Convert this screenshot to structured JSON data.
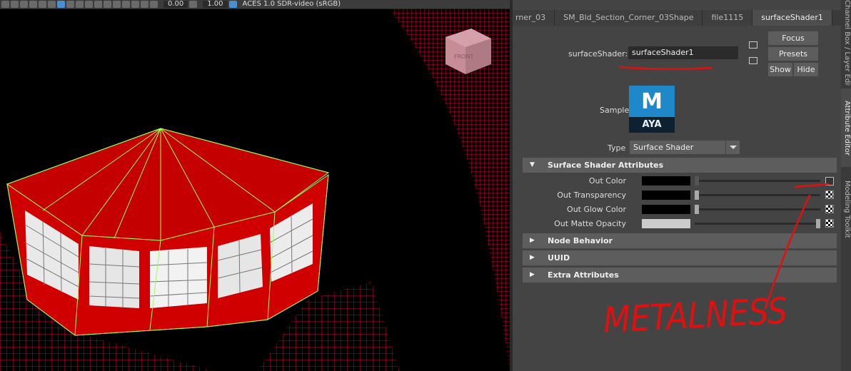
{
  "viewport": {
    "toolbar": {
      "field_a": "0.00",
      "field_b": "1.00",
      "color_space": "ACES 1.0 SDR-video (sRGB)"
    },
    "viewcube": {
      "face_label": "FRONT"
    },
    "object_color": "#d10000",
    "wireframe_color": "#9dff57",
    "grid_color": "#c2003b"
  },
  "attribute_editor": {
    "tabs": [
      "rner_03",
      "SM_Bld_Section_Corner_03Shape",
      "file1115",
      "surfaceShader1"
    ],
    "active_tab": "surfaceShader1",
    "shader_label": "surfaceShader:",
    "shader_name": "surfaceShader1",
    "buttons": {
      "focus": "Focus",
      "presets": "Presets",
      "show": "Show",
      "hide": "Hide"
    },
    "sample_label": "Sample",
    "sample_icon": {
      "top": "M",
      "bottom": "AYA"
    },
    "type_label": "Type",
    "type_value": "Surface Shader",
    "sections": {
      "surface_shader_attributes": "Surface Shader Attributes",
      "node_behavior": "Node Behavior",
      "uuid": "UUID",
      "extra_attributes": "Extra Attributes"
    },
    "attributes": [
      {
        "label": "Out Color",
        "swatch": "#000000",
        "slider": 0.0,
        "connected": true
      },
      {
        "label": "Out Transparency",
        "swatch": "#000000",
        "slider": 0.0,
        "connected": false
      },
      {
        "label": "Out Glow Color",
        "swatch": "#000000",
        "slider": 0.0,
        "connected": false
      },
      {
        "label": "Out Matte Opacity",
        "swatch": "#cccccc",
        "slider": 1.0,
        "connected": false
      }
    ],
    "annotation_text": "METALNESS",
    "annotation_color": "#e01010"
  },
  "side_tabs": [
    "Channel Box / Layer Editor",
    "Attribute Editor",
    "Modeling Toolkit"
  ]
}
